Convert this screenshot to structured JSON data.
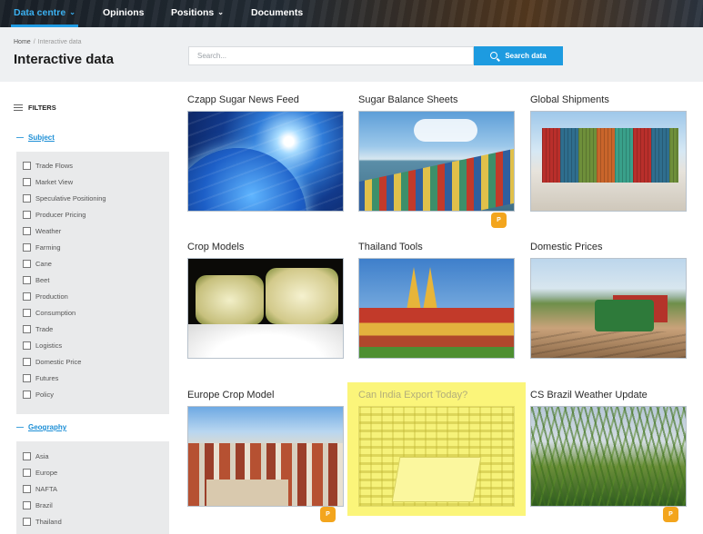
{
  "nav": {
    "items": [
      {
        "label": "Data centre",
        "has_dropdown": true,
        "active": true
      },
      {
        "label": "Opinions",
        "has_dropdown": false,
        "active": false
      },
      {
        "label": "Positions",
        "has_dropdown": true,
        "active": false
      },
      {
        "label": "Documents",
        "has_dropdown": false,
        "active": false
      }
    ]
  },
  "breadcrumb": {
    "home": "Home",
    "separator": "/",
    "current": "Interactive data"
  },
  "page_title": "Interactive data",
  "search": {
    "placeholder": "Search...",
    "value": "",
    "button_label": "Search data"
  },
  "filters": {
    "heading": "FILTERS",
    "groups": [
      {
        "label": "Subject",
        "toggle": "—",
        "options": [
          "Trade Flows",
          "Market View",
          "Speculative Positioning",
          "Producer Pricing",
          "Weather",
          "Farming",
          "Cane",
          "Beet",
          "Production",
          "Consumption",
          "Trade",
          "Logistics",
          "Domestic Price",
          "Futures",
          "Policy"
        ]
      },
      {
        "label": "Geography",
        "toggle": "—",
        "options": [
          "Asia",
          "Europe",
          "NAFTA",
          "Brazil",
          "Thailand"
        ]
      }
    ]
  },
  "tiles": [
    {
      "title": "Czapp Sugar News Feed",
      "image": "globe-news-image",
      "premium": false,
      "highlighted": false
    },
    {
      "title": "Sugar Balance Sheets",
      "image": "container-ship-image",
      "premium": true,
      "highlighted": false
    },
    {
      "title": "Global Shipments",
      "image": "shipping-containers-image",
      "premium": false,
      "highlighted": false
    },
    {
      "title": "Crop Models",
      "image": "sugar-cane-cross-section-image",
      "premium": false,
      "highlighted": false
    },
    {
      "title": "Thailand Tools",
      "image": "thai-temple-image",
      "premium": false,
      "highlighted": false
    },
    {
      "title": "Domestic Prices",
      "image": "cane-harvest-tractor-image",
      "premium": false,
      "highlighted": false
    },
    {
      "title": "Europe Crop Model",
      "image": "european-old-town-image",
      "premium": true,
      "highlighted": false
    },
    {
      "title": "Can India Export Today?",
      "image": "sugar-sacks-warehouse-image",
      "premium": false,
      "highlighted": true
    },
    {
      "title": "CS Brazil Weather Update",
      "image": "sugar-cane-field-image",
      "premium": true,
      "highlighted": false
    }
  ],
  "badge_label": "P",
  "colors": {
    "accent": "#1d9be0",
    "premium_badge": "#f3a51d",
    "highlight": "#fbf57a"
  }
}
